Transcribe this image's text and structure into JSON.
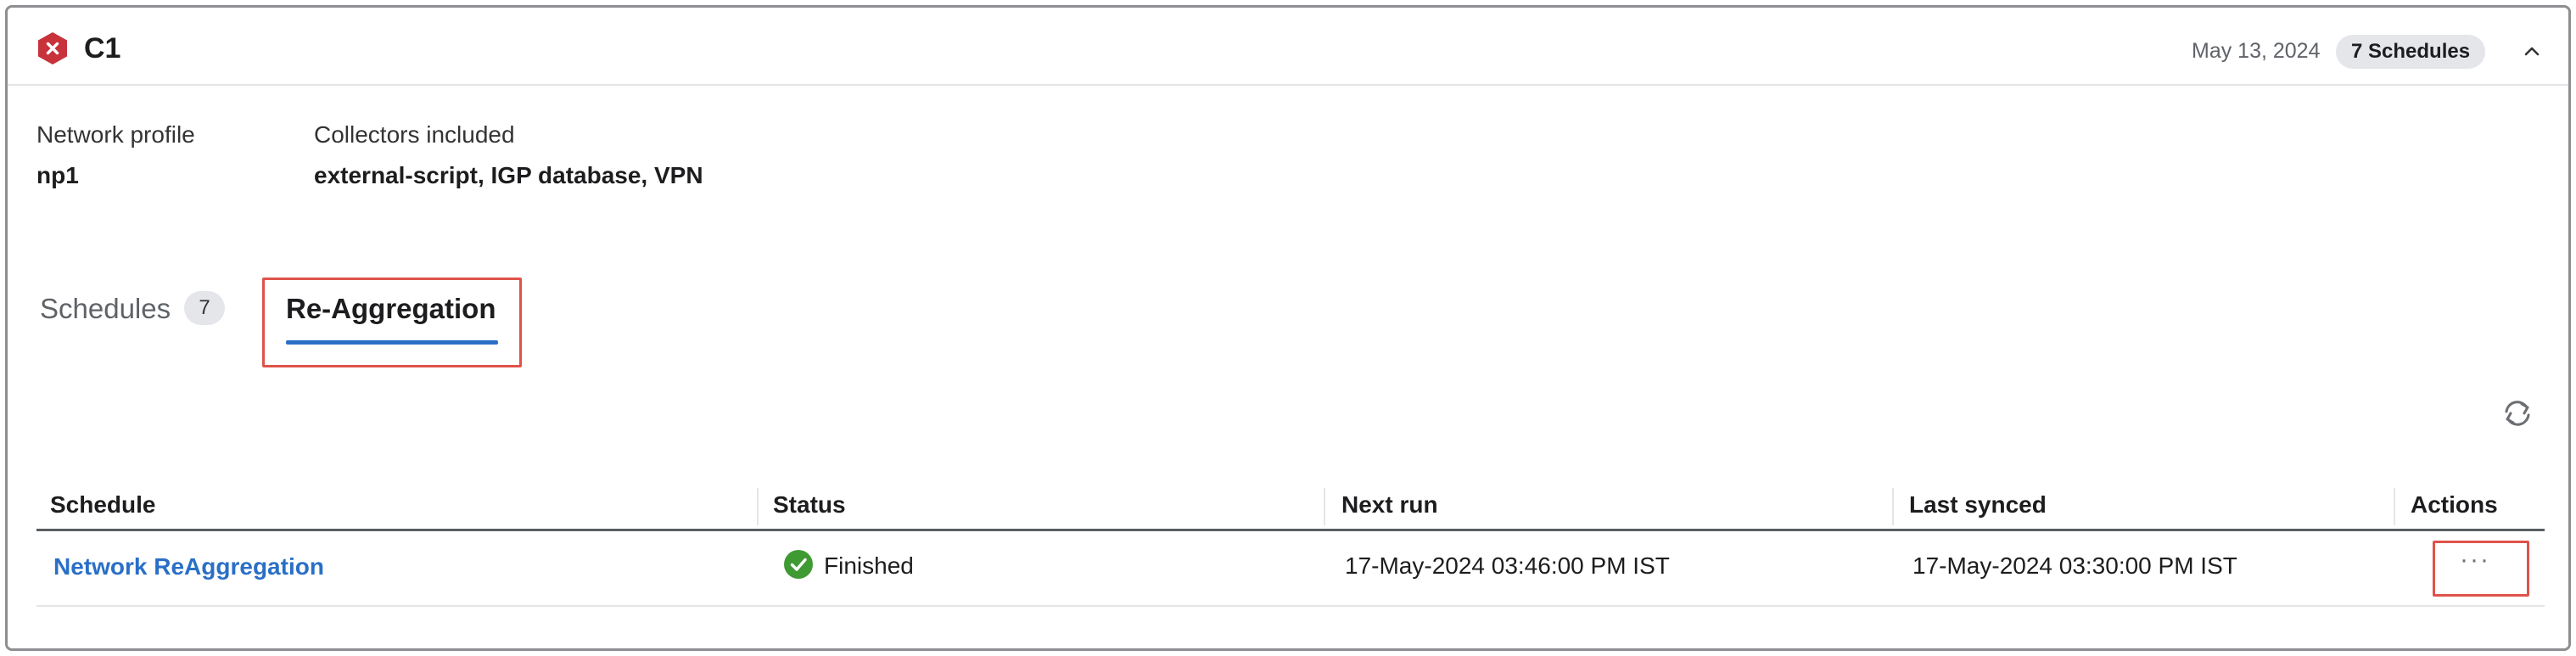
{
  "header": {
    "title": "C1",
    "date": "May 13, 2024",
    "schedules_badge": "7 Schedules",
    "status_color": "#c8323b"
  },
  "meta": {
    "network_profile_label": "Network profile",
    "network_profile_value": "np1",
    "collectors_label": "Collectors included",
    "collectors_value": "external-script, IGP database, VPN"
  },
  "tabs": [
    {
      "label": "Schedules",
      "count": "7",
      "active": false
    },
    {
      "label": "Re-Aggregation",
      "active": true
    }
  ],
  "table": {
    "columns": [
      "Schedule",
      "Status",
      "Next run",
      "Last synced",
      "Actions"
    ],
    "rows": [
      {
        "schedule": "Network ReAggregation",
        "status": "Finished",
        "next_run": "17-May-2024 03:46:00 PM IST",
        "last_synced": "17-May-2024 03:30:00 PM IST",
        "actions": "···"
      }
    ]
  },
  "colors": {
    "accent": "#2a6fc6",
    "success": "#3f9a34",
    "highlight": "#e0524b"
  }
}
